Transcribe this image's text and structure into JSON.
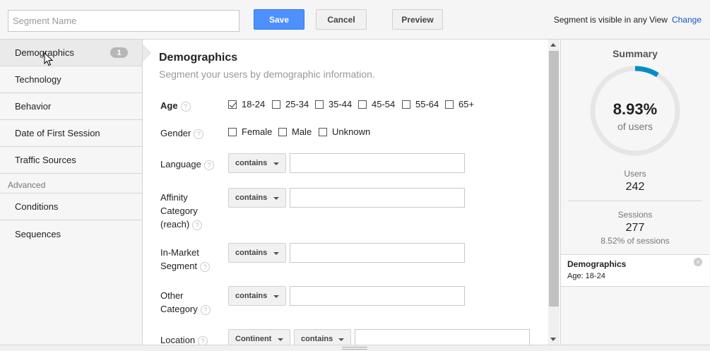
{
  "toolbar": {
    "segment_name_placeholder": "Segment Name",
    "save_label": "Save",
    "cancel_label": "Cancel",
    "preview_label": "Preview",
    "visibility_text": "Segment is visible in any View",
    "change_label": "Change"
  },
  "sidebar": {
    "items": [
      {
        "label": "Demographics",
        "badge": "1"
      },
      {
        "label": "Technology"
      },
      {
        "label": "Behavior"
      },
      {
        "label": "Date of First Session"
      },
      {
        "label": "Traffic Sources"
      }
    ],
    "advanced_header": "Advanced",
    "advanced_items": [
      {
        "label": "Conditions"
      },
      {
        "label": "Sequences"
      }
    ]
  },
  "main": {
    "title": "Demographics",
    "subtitle": "Segment your users by demographic information.",
    "help_glyph": "?",
    "age": {
      "label": "Age",
      "options": [
        {
          "label": "18-24",
          "checked": true
        },
        {
          "label": "25-34",
          "checked": false
        },
        {
          "label": "35-44",
          "checked": false
        },
        {
          "label": "45-54",
          "checked": false
        },
        {
          "label": "55-64",
          "checked": false
        },
        {
          "label": "65+",
          "checked": false
        }
      ]
    },
    "gender": {
      "label": "Gender",
      "options": [
        {
          "label": "Female",
          "checked": false
        },
        {
          "label": "Male",
          "checked": false
        },
        {
          "label": "Unknown",
          "checked": false
        }
      ]
    },
    "language": {
      "label": "Language",
      "operator": "contains",
      "value": ""
    },
    "affinity": {
      "label_lines": [
        "Affinity",
        "Category",
        "(reach)"
      ],
      "operator": "contains",
      "value": ""
    },
    "in_market": {
      "label_lines": [
        "In-Market",
        "Segment"
      ],
      "operator": "contains",
      "value": ""
    },
    "other": {
      "label_lines": [
        "Other",
        "Category"
      ],
      "operator": "contains",
      "value": ""
    },
    "location": {
      "label": "Location",
      "scope": "Continent",
      "operator": "contains",
      "value": ""
    }
  },
  "summary": {
    "title": "Summary",
    "percent": "8.93%",
    "percent_value": 0.0893,
    "percent_label": "of users",
    "users_label": "Users",
    "users_value": "242",
    "sessions_label": "Sessions",
    "sessions_value": "277",
    "sessions_pct": "8.52% of sessions",
    "condition": {
      "title": "Demographics",
      "detail": "Age: 18-24",
      "close_glyph": "×"
    },
    "ring_color": "#058dc7",
    "ring_bg": "#e6e6e6"
  }
}
